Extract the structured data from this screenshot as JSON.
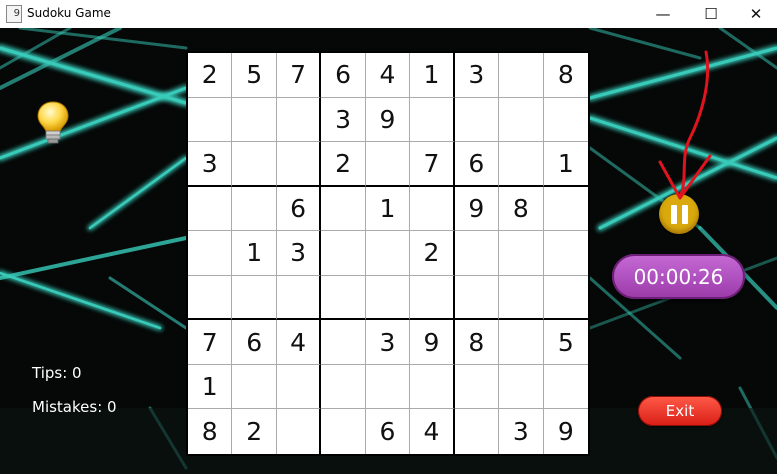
{
  "window": {
    "title": "Sudoku Game",
    "app_icon_glyph": "9",
    "controls": {
      "minimize": "—",
      "maximize": "☐",
      "close": "✕"
    }
  },
  "board": {
    "cells": [
      [
        "2",
        "5",
        "7",
        "6",
        "4",
        "1",
        "3",
        "",
        "8"
      ],
      [
        "",
        "",
        "",
        "3",
        "9",
        "",
        "",
        "",
        ""
      ],
      [
        "3",
        "",
        "",
        "2",
        "",
        "7",
        "6",
        "",
        "1"
      ],
      [
        "",
        "",
        "6",
        "",
        "1",
        "",
        "9",
        "8",
        ""
      ],
      [
        "",
        "1",
        "3",
        "",
        "",
        "2",
        "",
        "",
        ""
      ],
      [
        "",
        "",
        "",
        "",
        "",
        "",
        "",
        "",
        ""
      ],
      [
        "7",
        "6",
        "4",
        "",
        "3",
        "9",
        "8",
        "",
        "5"
      ],
      [
        "1",
        "",
        "",
        "",
        "",
        "",
        "",
        "",
        ""
      ],
      [
        "8",
        "2",
        "",
        "",
        "6",
        "4",
        "",
        "3",
        "9"
      ]
    ]
  },
  "hint": {
    "icon": "lightbulb-icon"
  },
  "pause": {
    "icon": "pause-icon",
    "color": "#d9a90d"
  },
  "timer": {
    "value": "00:00:26",
    "color": "#b04fc0"
  },
  "exit": {
    "label": "Exit",
    "color": "#e8291f"
  },
  "stats": {
    "tips": "Tips: 0",
    "mistakes": "Mistakes: 0"
  },
  "annotation": {
    "arrow_color": "#e0141e"
  },
  "background": {
    "base": "#050807",
    "beam": "#3fe3d0"
  }
}
